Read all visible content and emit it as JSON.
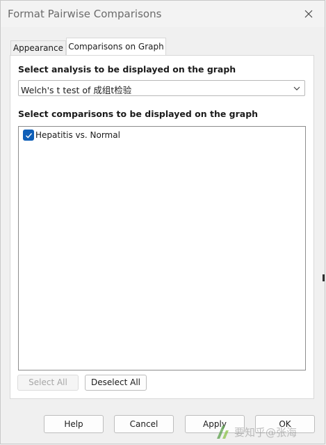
{
  "window": {
    "title": "Format Pairwise Comparisons"
  },
  "tabs": [
    {
      "label": "Appearance",
      "active": false
    },
    {
      "label": "Comparisons on Graph",
      "active": true
    }
  ],
  "analysis": {
    "label": "Select analysis to be displayed on the graph",
    "selected_value": "Welch's t test of 成组t检验"
  },
  "comparisons": {
    "label": "Select comparisons to be displayed on the graph",
    "items": [
      {
        "label": "Hepatitis vs. Normal",
        "checked": true
      }
    ],
    "select_all_label": "Select All",
    "select_all_enabled": false,
    "deselect_all_label": "Deselect All"
  },
  "footer": {
    "help_label": "Help",
    "cancel_label": "Cancel",
    "apply_label": "Apply",
    "ok_label": "OK"
  },
  "watermark": {
    "text": "要知乎@张海"
  },
  "colors": {
    "accent": "#0f5fb8",
    "dialog_bg": "#f0f0f0",
    "panel_bg": "#ffffff",
    "disabled_text": "#a6a6a6"
  }
}
